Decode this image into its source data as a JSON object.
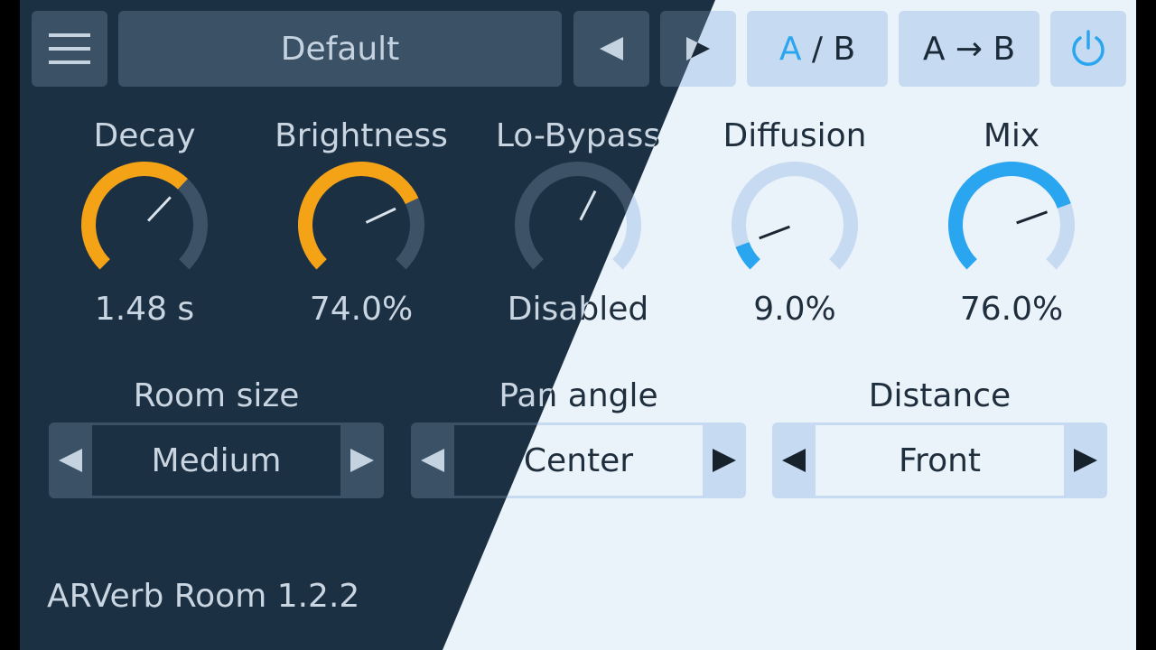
{
  "toolbar": {
    "menu_icon": "hamburger-menu-icon",
    "preset_name": "Default",
    "prev_icon": "triangle-left-icon",
    "next_icon": "triangle-right-icon",
    "ab_label_a": "A",
    "ab_label_sep": " / B",
    "copy_label": "A → B",
    "power_icon": "power-icon"
  },
  "knobs": [
    {
      "id": "decay",
      "label": "Decay",
      "value": "1.48 s",
      "fraction": 0.66
    },
    {
      "id": "brightness",
      "label": "Brightness",
      "value": "74.0%",
      "fraction": 0.74
    },
    {
      "id": "lo-bypass",
      "label": "Lo-Bypass",
      "value": "Disabled",
      "fraction": 0.6
    },
    {
      "id": "diffusion",
      "label": "Diffusion",
      "value": "9.0%",
      "fraction": 0.09
    },
    {
      "id": "mix",
      "label": "Mix",
      "value": "76.0%",
      "fraction": 0.76
    }
  ],
  "steppers": [
    {
      "id": "room-size",
      "label": "Room size",
      "value": "Medium"
    },
    {
      "id": "pan-angle",
      "label": "Pan angle",
      "value": "Center"
    },
    {
      "id": "distance",
      "label": "Distance",
      "value": "Front"
    }
  ],
  "footer": {
    "version": "ARVerb Room 1.2.2"
  },
  "colors": {
    "dark_bg": "#1c3044",
    "light_bg": "#eaf2fa",
    "dark_accent": "#f5a316",
    "light_accent": "#2aa6f0"
  }
}
